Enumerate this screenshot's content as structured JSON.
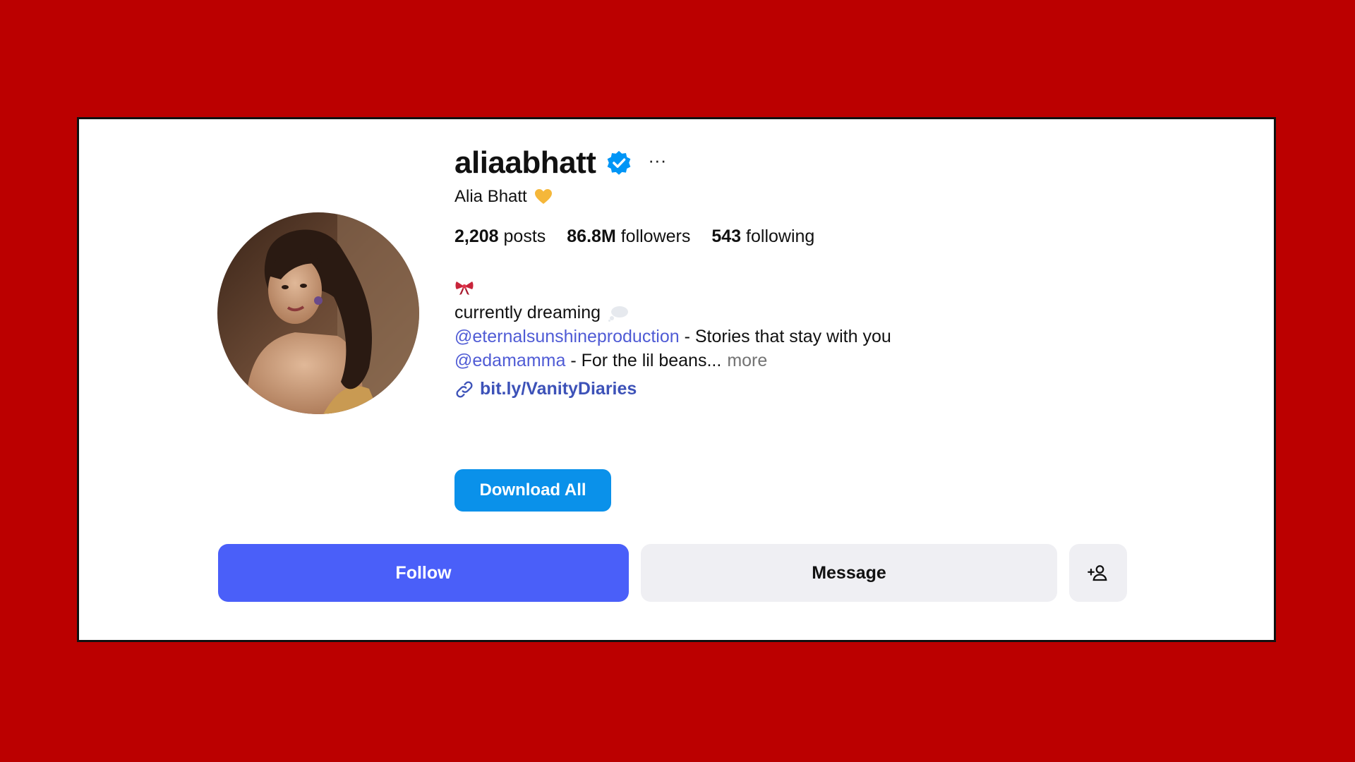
{
  "profile": {
    "username": "aliaabhatt",
    "full_name": "Alia Bhatt",
    "verified": true,
    "more_label": "···"
  },
  "stats": {
    "posts_count": "2,208",
    "posts_label": "posts",
    "followers_count": "86.8M",
    "followers_label": "followers",
    "following_count": "543",
    "following_label": "following"
  },
  "bio": {
    "line1": "currently dreaming",
    "line2_mention": "@eternalsunshineproduction",
    "line2_text": " - Stories that stay with you",
    "line3_mention": "@edamamma",
    "line3_text": " - For the lil beans...",
    "more_label": "more",
    "link": "bit.ly/VanityDiaries"
  },
  "actions": {
    "download_all": "Download All",
    "follow": "Follow",
    "message": "Message"
  },
  "icons": {
    "verified": "verified-badge-icon",
    "heart": "yellow-heart-icon",
    "bow": "ribbon-bow-icon",
    "thought": "thought-bubble-icon",
    "link": "link-icon",
    "add_user": "add-user-icon"
  },
  "colors": {
    "background": "#bb0000",
    "follow_button": "#4a5ff9",
    "download_button": "#0a91ea",
    "mention": "#4f5bd5",
    "link": "#3d52b8",
    "secondary_button": "#efeff3",
    "verified": "#0095f6"
  }
}
